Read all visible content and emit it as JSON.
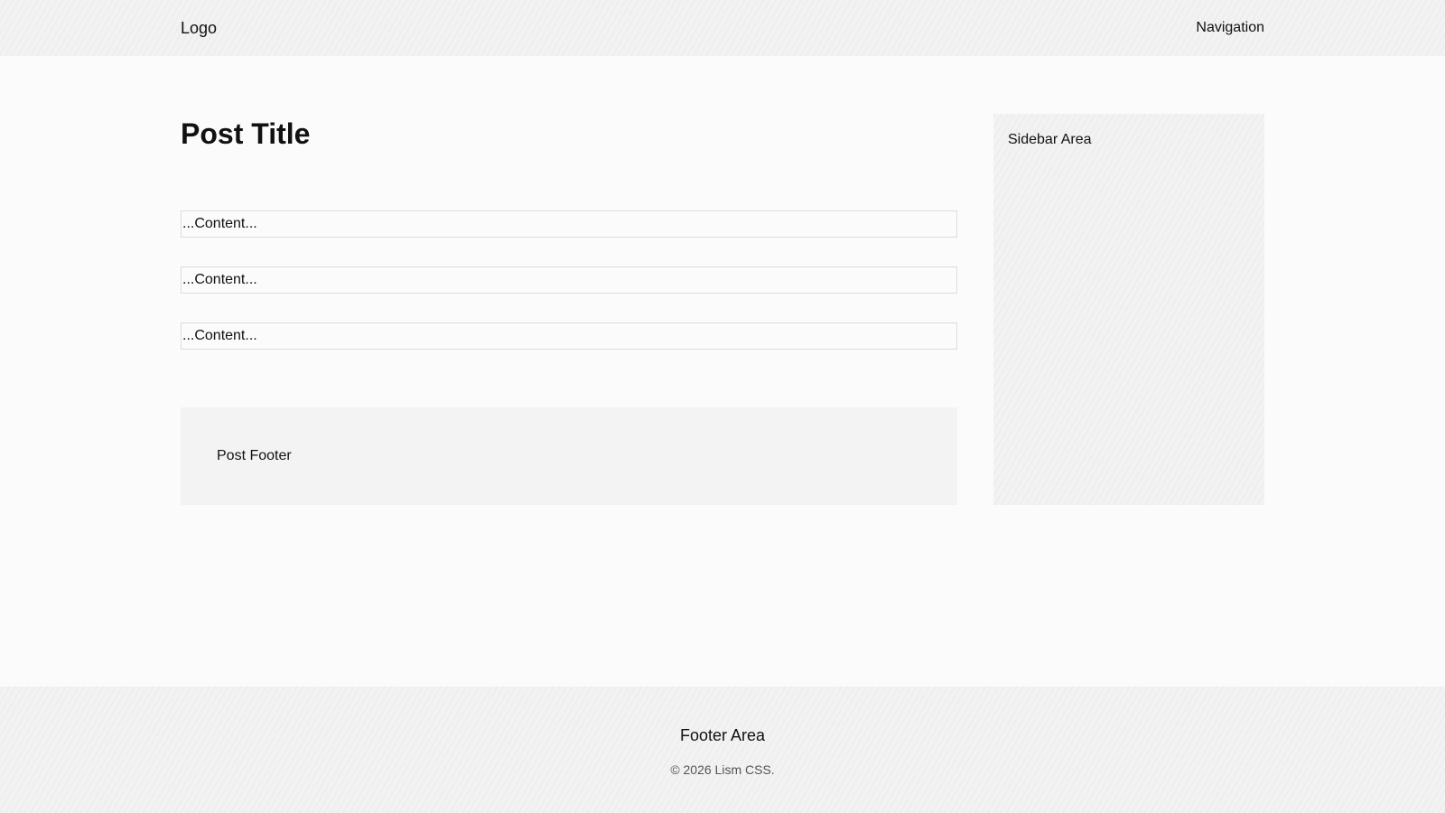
{
  "header": {
    "logo": "Logo",
    "navigation": "Navigation"
  },
  "post": {
    "title": "Post Title",
    "content_blocks": [
      "...Content...",
      "...Content...",
      "...Content..."
    ],
    "footer": "Post Footer"
  },
  "sidebar": {
    "label": "Sidebar Area"
  },
  "footer": {
    "title": "Footer Area",
    "copyright": "© 2026 Lism CSS."
  },
  "colors": {
    "page_background": "#fbfbfb",
    "hatched_background": "#f2f2f2",
    "post_footer_background": "#f3f3f3",
    "content_border": "#dcdcdc"
  }
}
